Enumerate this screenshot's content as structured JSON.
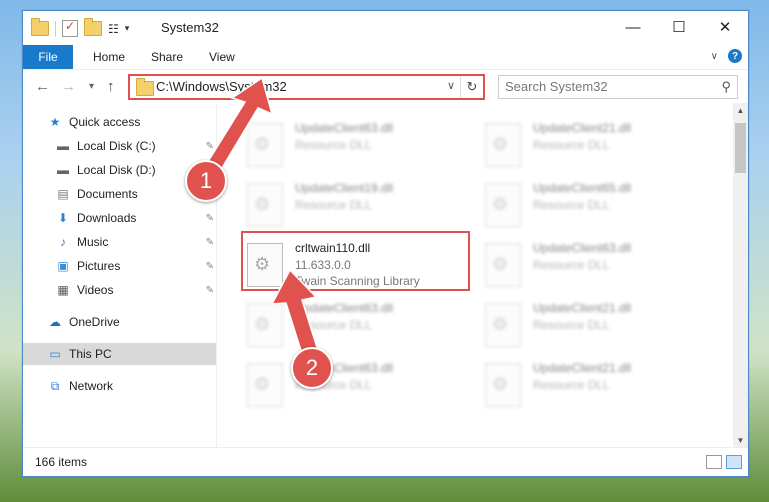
{
  "window": {
    "title": "System32",
    "quick_access_dropdown": "▾",
    "controls": {
      "minimize": "—",
      "maximize": "☐",
      "close": "✕"
    }
  },
  "ribbon": {
    "tabs": [
      "File",
      "Home",
      "Share",
      "View"
    ],
    "expand_icon": "chevron-down-icon",
    "help_icon": "?"
  },
  "address": {
    "back": "←",
    "forward": "→",
    "recent": "▾",
    "up": "↑",
    "path": "C:\\Windows\\System32",
    "dropdown": "∨",
    "refresh": "↻",
    "search_placeholder": "Search System32",
    "search_icon": "⚲"
  },
  "nav": {
    "items": [
      {
        "label": "Quick access",
        "icon": "★",
        "icon_name": "star-icon",
        "pinned": false
      },
      {
        "label": "Local Disk (C:)",
        "icon": "▬",
        "icon_name": "drive-icon",
        "pinned": true
      },
      {
        "label": "Local Disk (D:)",
        "icon": "▬",
        "icon_name": "drive-icon",
        "pinned": false
      },
      {
        "label": "Documents",
        "icon": "▤",
        "icon_name": "documents-icon",
        "pinned": true
      },
      {
        "label": "Downloads",
        "icon": "⬇",
        "icon_name": "downloads-icon",
        "pinned": true
      },
      {
        "label": "Music",
        "icon": "♪",
        "icon_name": "music-icon",
        "pinned": true
      },
      {
        "label": "Pictures",
        "icon": "▣",
        "icon_name": "pictures-icon",
        "pinned": true
      },
      {
        "label": "Videos",
        "icon": "▦",
        "icon_name": "videos-icon",
        "pinned": true
      },
      {
        "label": "OneDrive",
        "icon": "☁",
        "icon_name": "onedrive-icon",
        "pinned": false
      },
      {
        "label": "This PC",
        "icon": "▭",
        "icon_name": "this-pc-icon",
        "pinned": false
      },
      {
        "label": "Network",
        "icon": "⧉",
        "icon_name": "network-icon",
        "pinned": false
      }
    ],
    "pin_icon": "✎"
  },
  "files": {
    "highlighted": {
      "name": "crltwain110.dll",
      "version": "11.633.0.0",
      "description": "Twain Scanning Library"
    },
    "background": [
      {
        "name": "UpdateClient63.dll",
        "description": "Resource DLL"
      },
      {
        "name": "UpdateClient21.dll",
        "description": "Resource DLL"
      },
      {
        "name": "UpdateClient19.dll",
        "description": "Resource DLL"
      },
      {
        "name": "UpdateClient65.dll",
        "description": "Resource DLL"
      },
      {
        "name": "UpdateClient63.dll",
        "description": "Resource DLL"
      },
      {
        "name": "UpdateClient63.dll",
        "description": "Resource DLL"
      },
      {
        "name": "UpdateClient21.dll",
        "description": "Resource DLL"
      },
      {
        "name": "UpdateClient63.dll",
        "description": "Resource DLL"
      },
      {
        "name": "UpdateClient21.dll",
        "description": "Resource DLL"
      }
    ]
  },
  "status": {
    "item_count": "166 items"
  },
  "callouts": [
    "1",
    "2"
  ],
  "colors": {
    "accent": "#1979ca",
    "highlight": "#e05050"
  }
}
